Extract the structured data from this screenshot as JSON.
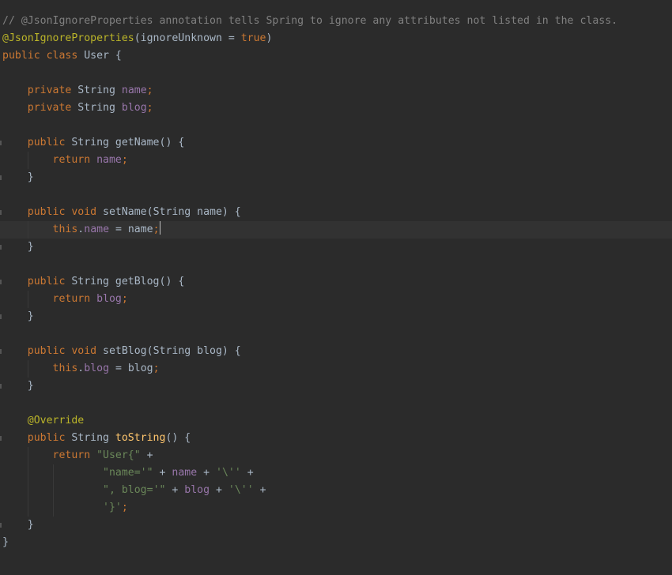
{
  "editor": {
    "current_line": 13,
    "lines": [
      {
        "tokens": [
          {
            "t": "comment",
            "v": "// @JsonIgnoreProperties annotation tells Spring to ignore any attributes not listed in the class."
          }
        ]
      },
      {
        "tokens": [
          {
            "t": "annot",
            "v": "@JsonIgnoreProperties"
          },
          {
            "t": "plain",
            "v": "(ignoreUnknown = "
          },
          {
            "t": "kw",
            "v": "true"
          },
          {
            "t": "plain",
            "v": ")"
          }
        ]
      },
      {
        "tokens": [
          {
            "t": "kw",
            "v": "public class "
          },
          {
            "t": "plain",
            "v": "User {"
          }
        ]
      },
      {
        "tokens": []
      },
      {
        "tokens": [
          {
            "t": "plain",
            "v": "    "
          },
          {
            "t": "kw",
            "v": "private "
          },
          {
            "t": "plain",
            "v": "String "
          },
          {
            "t": "field",
            "v": "name"
          },
          {
            "t": "kw",
            "v": ";"
          }
        ]
      },
      {
        "tokens": [
          {
            "t": "plain",
            "v": "    "
          },
          {
            "t": "kw",
            "v": "private "
          },
          {
            "t": "plain",
            "v": "String "
          },
          {
            "t": "field",
            "v": "blog"
          },
          {
            "t": "kw",
            "v": ";"
          }
        ]
      },
      {
        "tokens": []
      },
      {
        "fold": true,
        "tokens": [
          {
            "t": "plain",
            "v": "    "
          },
          {
            "t": "kw",
            "v": "public "
          },
          {
            "t": "plain",
            "v": "String "
          },
          {
            "t": "meth-plain",
            "v": "getName"
          },
          {
            "t": "plain",
            "v": "() {"
          }
        ]
      },
      {
        "guides": [
          1
        ],
        "tokens": [
          {
            "t": "plain",
            "v": "        "
          },
          {
            "t": "kw",
            "v": "return "
          },
          {
            "t": "field",
            "v": "name"
          },
          {
            "t": "kw",
            "v": ";"
          }
        ]
      },
      {
        "fold": true,
        "tokens": [
          {
            "t": "plain",
            "v": "    }"
          }
        ]
      },
      {
        "tokens": []
      },
      {
        "fold": true,
        "tokens": [
          {
            "t": "plain",
            "v": "    "
          },
          {
            "t": "kw",
            "v": "public void "
          },
          {
            "t": "meth-plain",
            "v": "setName"
          },
          {
            "t": "plain",
            "v": "(String name) {"
          }
        ]
      },
      {
        "guides": [
          1
        ],
        "tokens": [
          {
            "t": "plain",
            "v": "        "
          },
          {
            "t": "kw",
            "v": "this"
          },
          {
            "t": "plain",
            "v": "."
          },
          {
            "t": "field",
            "v": "name"
          },
          {
            "t": "plain",
            "v": " = name"
          },
          {
            "t": "kw",
            "v": ";"
          }
        ],
        "caret": true
      },
      {
        "fold": true,
        "tokens": [
          {
            "t": "plain",
            "v": "    }"
          }
        ]
      },
      {
        "tokens": []
      },
      {
        "fold": true,
        "tokens": [
          {
            "t": "plain",
            "v": "    "
          },
          {
            "t": "kw",
            "v": "public "
          },
          {
            "t": "plain",
            "v": "String "
          },
          {
            "t": "meth-plain",
            "v": "getBlog"
          },
          {
            "t": "plain",
            "v": "() {"
          }
        ]
      },
      {
        "guides": [
          1
        ],
        "tokens": [
          {
            "t": "plain",
            "v": "        "
          },
          {
            "t": "kw",
            "v": "return "
          },
          {
            "t": "field",
            "v": "blog"
          },
          {
            "t": "kw",
            "v": ";"
          }
        ]
      },
      {
        "fold": true,
        "tokens": [
          {
            "t": "plain",
            "v": "    }"
          }
        ]
      },
      {
        "tokens": []
      },
      {
        "fold": true,
        "tokens": [
          {
            "t": "plain",
            "v": "    "
          },
          {
            "t": "kw",
            "v": "public void "
          },
          {
            "t": "meth-plain",
            "v": "setBlog"
          },
          {
            "t": "plain",
            "v": "(String blog) {"
          }
        ]
      },
      {
        "guides": [
          1
        ],
        "tokens": [
          {
            "t": "plain",
            "v": "        "
          },
          {
            "t": "kw",
            "v": "this"
          },
          {
            "t": "plain",
            "v": "."
          },
          {
            "t": "field",
            "v": "blog"
          },
          {
            "t": "plain",
            "v": " = blog"
          },
          {
            "t": "kw",
            "v": ";"
          }
        ]
      },
      {
        "fold": true,
        "tokens": [
          {
            "t": "plain",
            "v": "    }"
          }
        ]
      },
      {
        "tokens": []
      },
      {
        "tokens": [
          {
            "t": "plain",
            "v": "    "
          },
          {
            "t": "annot",
            "v": "@Override"
          }
        ]
      },
      {
        "fold": true,
        "tokens": [
          {
            "t": "plain",
            "v": "    "
          },
          {
            "t": "kw",
            "v": "public "
          },
          {
            "t": "plain",
            "v": "String "
          },
          {
            "t": "method",
            "v": "toString"
          },
          {
            "t": "plain",
            "v": "() {"
          }
        ]
      },
      {
        "guides": [
          1
        ],
        "tokens": [
          {
            "t": "plain",
            "v": "        "
          },
          {
            "t": "kw",
            "v": "return "
          },
          {
            "t": "str",
            "v": "\"User{\""
          },
          {
            "t": "plain",
            "v": " +"
          }
        ]
      },
      {
        "guides": [
          1,
          2
        ],
        "tokens": [
          {
            "t": "plain",
            "v": "                "
          },
          {
            "t": "str",
            "v": "\"name='\""
          },
          {
            "t": "plain",
            "v": " + "
          },
          {
            "t": "field",
            "v": "name"
          },
          {
            "t": "plain",
            "v": " + "
          },
          {
            "t": "str",
            "v": "'\\''"
          },
          {
            "t": "plain",
            "v": " +"
          }
        ]
      },
      {
        "guides": [
          1,
          2
        ],
        "tokens": [
          {
            "t": "plain",
            "v": "                "
          },
          {
            "t": "str",
            "v": "\", blog='\""
          },
          {
            "t": "plain",
            "v": " + "
          },
          {
            "t": "field",
            "v": "blog"
          },
          {
            "t": "plain",
            "v": " + "
          },
          {
            "t": "str",
            "v": "'\\''"
          },
          {
            "t": "plain",
            "v": " +"
          }
        ]
      },
      {
        "guides": [
          1,
          2
        ],
        "tokens": [
          {
            "t": "plain",
            "v": "                "
          },
          {
            "t": "str",
            "v": "'}'"
          },
          {
            "t": "kw",
            "v": ";"
          }
        ]
      },
      {
        "fold": true,
        "tokens": [
          {
            "t": "plain",
            "v": "    }"
          }
        ]
      },
      {
        "tokens": [
          {
            "t": "plain",
            "v": "}"
          }
        ]
      }
    ]
  }
}
